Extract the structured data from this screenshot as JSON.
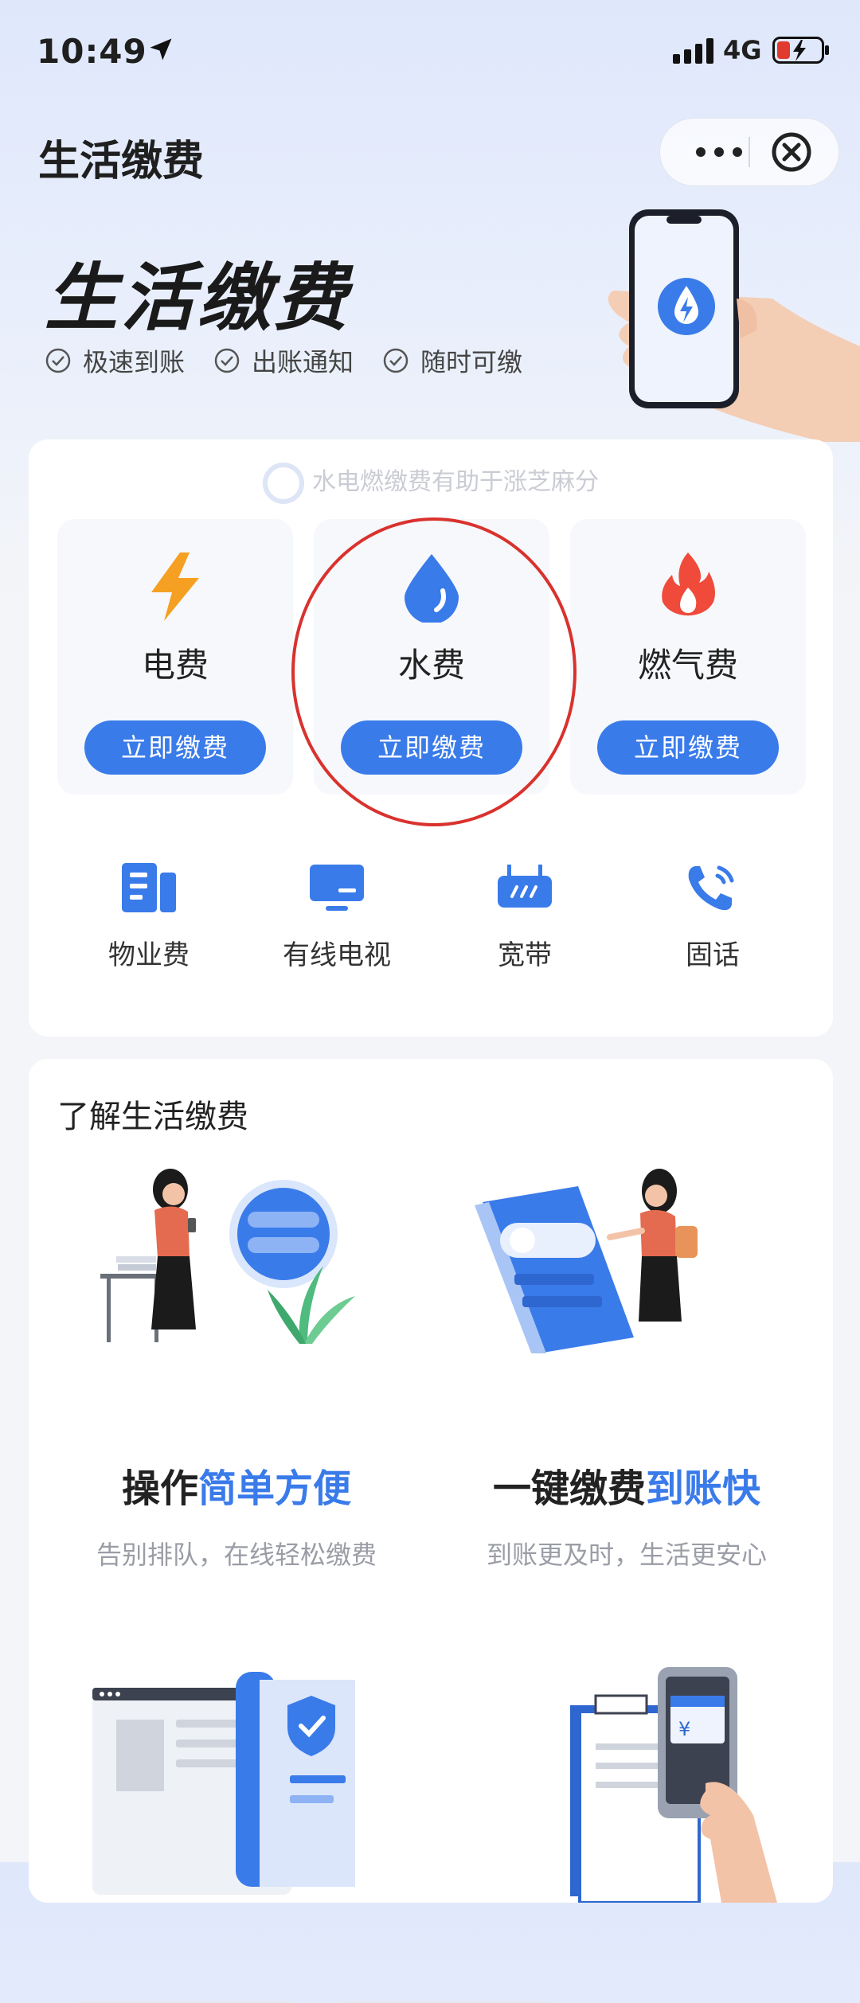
{
  "status_bar": {
    "time": "10:49",
    "network": "4G"
  },
  "header": {
    "title": "生活缴费"
  },
  "hero": {
    "title": "生活缴费",
    "features": [
      "极速到账",
      "出账通知",
      "随时可缴"
    ]
  },
  "notice": "水电燃缴费有助于涨芝麻分",
  "pay_items": [
    {
      "label": "电费",
      "button": "立即缴费"
    },
    {
      "label": "水费",
      "button": "立即缴费"
    },
    {
      "label": "燃气费",
      "button": "立即缴费"
    }
  ],
  "services": [
    {
      "label": "物业费"
    },
    {
      "label": "有线电视"
    },
    {
      "label": "宽带"
    },
    {
      "label": "固话"
    }
  ],
  "learn": {
    "title": "了解生活缴费",
    "items": [
      {
        "heading_a": "操作",
        "heading_b": "简单方便",
        "subtitle": "告别排队，在线轻松缴费"
      },
      {
        "heading_a": "一键缴费",
        "heading_b": "到账快",
        "subtitle": "到账更及时，生活更安心"
      }
    ]
  },
  "colors": {
    "accent": "#3a7bea",
    "highlight": "#d9322e",
    "electric": "#f5a023",
    "gas": "#f04a3a"
  }
}
